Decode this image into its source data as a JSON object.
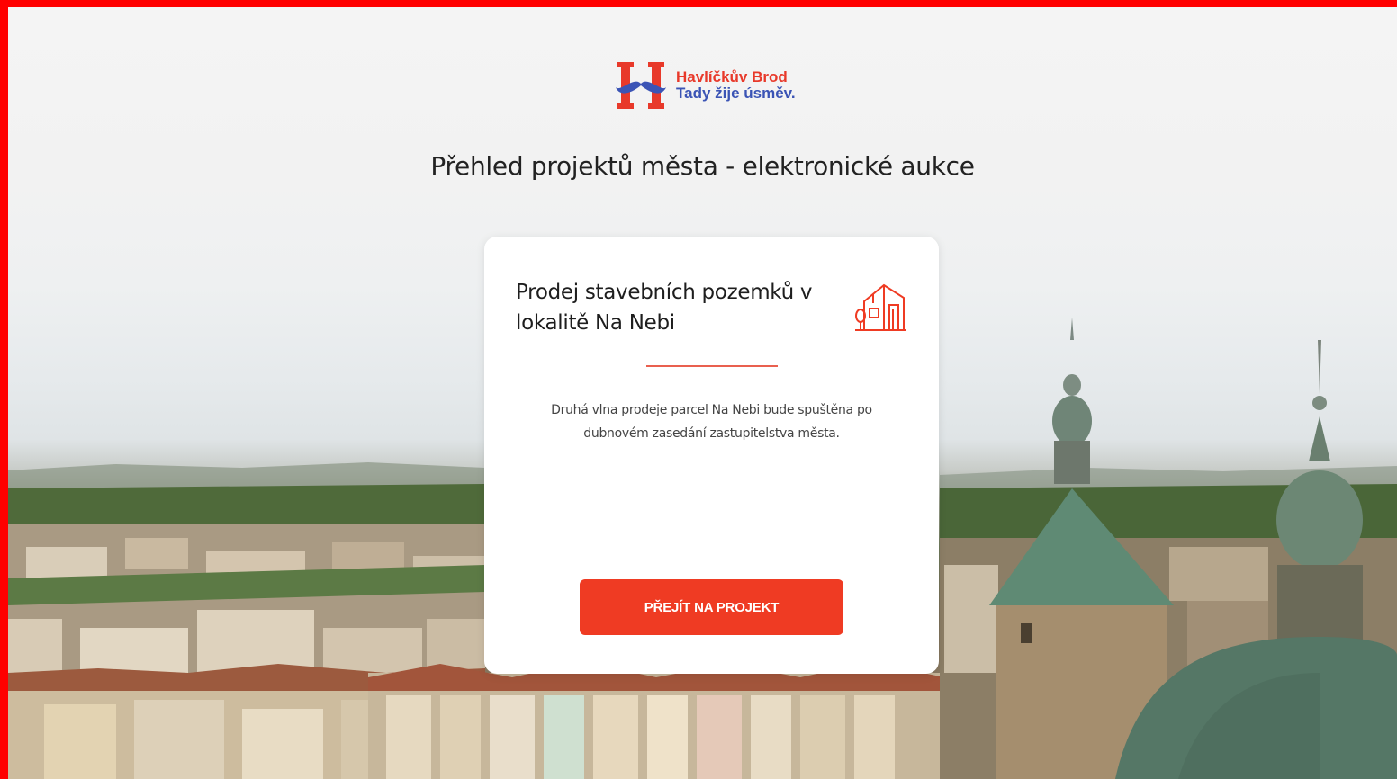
{
  "brand": {
    "name_line1": "Havlíčkův Brod",
    "name_line2": "Tady žije úsměv.",
    "logo_icon": "h-mustache-logo-icon",
    "primary_color": "#e8392a",
    "secondary_color": "#3b54b5"
  },
  "page": {
    "title": "Přehled projektů města - elektronické aukce"
  },
  "project_card": {
    "title": "Prodej stavebních pozemků v lokalitě Na Nebi",
    "icon": "building-icon",
    "description": "Druhá vlna prodeje parcel Na Nebi bude spuštěna po dubnovém zasedání zastupitelstva města.",
    "button_label": "PŘEJÍT NA PROJEKT",
    "accent_color": "#ef3b23"
  }
}
